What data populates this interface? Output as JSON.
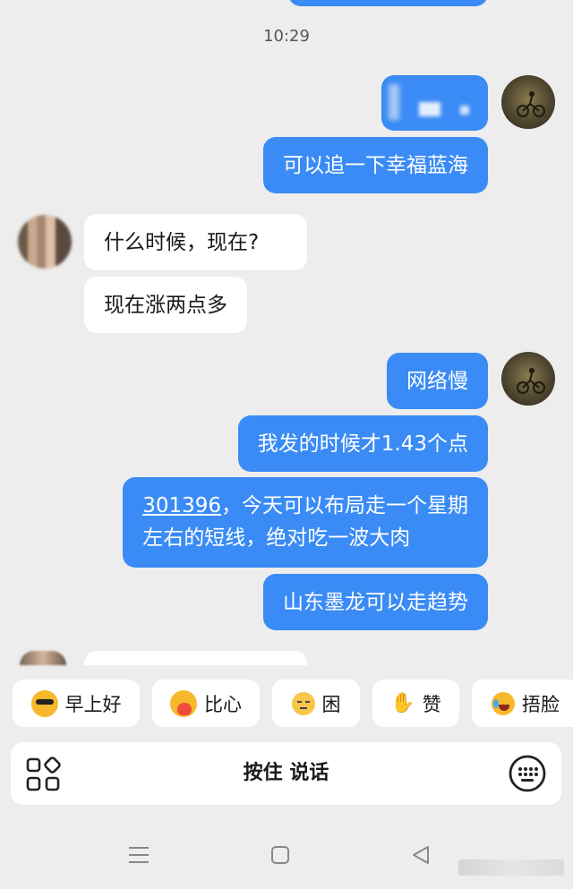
{
  "chat": {
    "timestamp": "10:29",
    "messages": [
      {
        "side": "out",
        "text": "可以追一下幸福蓝海"
      },
      {
        "side": "in",
        "text": "什么时候，现在?"
      },
      {
        "side": "in",
        "text": "现在涨两点多"
      },
      {
        "side": "out",
        "text": "网络慢"
      },
      {
        "side": "out",
        "text": "我发的时候才1.43个点"
      },
      {
        "side": "out",
        "link": "301396",
        "line1_rest": "，今天可以布局走一个星期",
        "line2": "左右的短线，绝对吃一波大肉"
      },
      {
        "side": "out",
        "text": "山东墨龙可以走趋势"
      }
    ]
  },
  "quick_replies": [
    "早上好",
    "比心",
    "困",
    "赞",
    "捂脸"
  ],
  "input": {
    "voice_label": "按住 说话",
    "left_icon": "apps-grid-icon",
    "right_icon": "keyboard-icon"
  },
  "nav": {
    "icons": [
      "menu-icon",
      "home-square-icon",
      "back-triangle-icon"
    ]
  },
  "colors": {
    "outgoing_bubble": "#3a8bf5",
    "incoming_bubble": "#ffffff",
    "background": "#ededed"
  }
}
